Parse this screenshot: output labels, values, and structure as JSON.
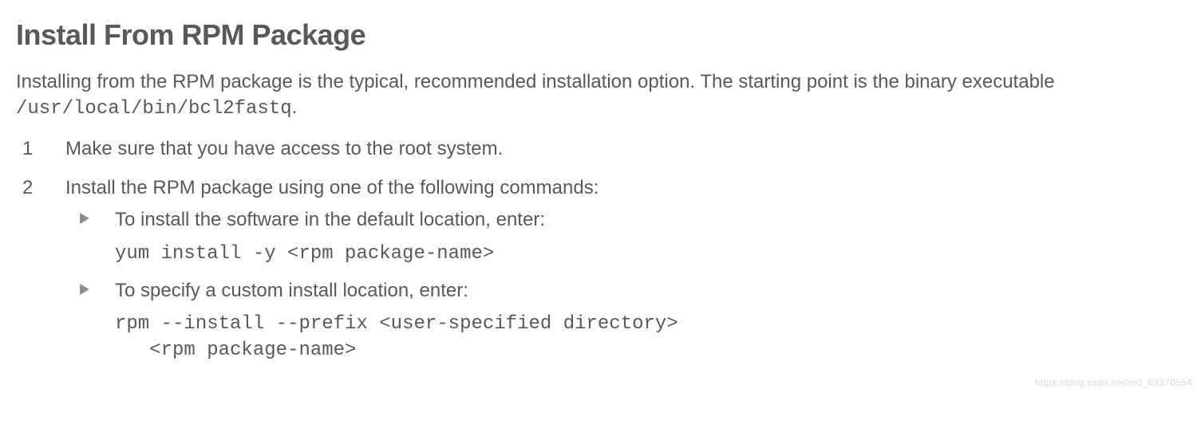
{
  "heading": "Install From RPM Package",
  "intro_prefix": "Installing from the RPM package is the typical, recommended installation option. The starting point is the binary executable ",
  "intro_code": "/usr/local/bin/bcl2fastq",
  "intro_suffix": ".",
  "steps": [
    {
      "text": "Make sure that you have access to the root system."
    },
    {
      "text": "Install the RPM package using one of the following commands:",
      "bullets": [
        {
          "text": "To install the software in the default location, enter:",
          "command": "yum install -y <rpm package-name>"
        },
        {
          "text": "To specify a custom install location, enter:",
          "command": "rpm --install --prefix <user-specified directory>\n   <rpm package-name>"
        }
      ]
    }
  ],
  "watermark": "https://blog.csdn.net/m0_62370554"
}
